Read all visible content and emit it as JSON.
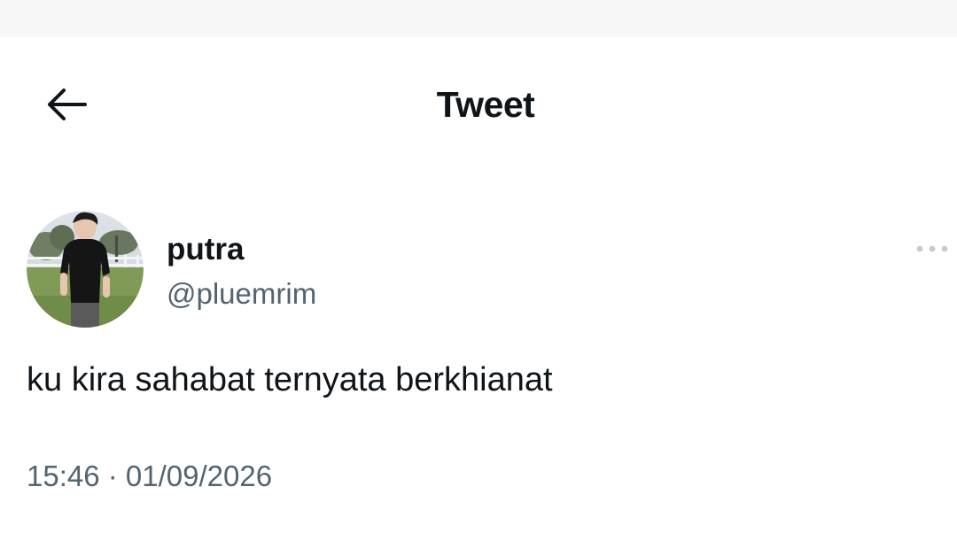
{
  "header": {
    "title": "Tweet",
    "back_icon": "arrow-left-icon"
  },
  "tweet": {
    "author": {
      "display_name": "putra",
      "handle": "@pluemrim",
      "avatar": "profile-photo"
    },
    "more_icon": "more-horizontal-icon",
    "text": "ku kira sahabat ternyata berkhianat",
    "time": "15:46",
    "separator": " · ",
    "date": "01/09/2026"
  },
  "colors": {
    "text_primary": "#0f1419",
    "text_secondary": "#536471",
    "background": "#ffffff"
  }
}
